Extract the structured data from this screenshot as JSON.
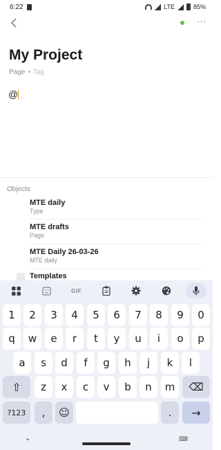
{
  "status": {
    "time": "6:22",
    "network": "LTE",
    "battery": "85%"
  },
  "page": {
    "title": "My Project",
    "type": "Page",
    "tag": "Tag",
    "editor_text": "@"
  },
  "objects": {
    "header": "Objects",
    "items": [
      {
        "name": "MTE daily",
        "sub": "Type"
      },
      {
        "name": "MTE drafts",
        "sub": "Page"
      },
      {
        "name": "MTE Daily 26-03-26",
        "sub": "MTE daily"
      },
      {
        "name": "Templates",
        "sub": ""
      }
    ]
  },
  "keyboard": {
    "toolbar": {
      "gif": "GIF"
    },
    "row_numbers": [
      "1",
      "2",
      "3",
      "4",
      "5",
      "6",
      "7",
      "8",
      "9",
      "0"
    ],
    "row_top": [
      "q",
      "w",
      "e",
      "r",
      "t",
      "y",
      "u",
      "i",
      "o",
      "p"
    ],
    "row_home": [
      "a",
      "s",
      "d",
      "f",
      "g",
      "h",
      "j",
      "k",
      "l"
    ],
    "row_bottom": [
      "z",
      "x",
      "c",
      "v",
      "b",
      "n",
      "m"
    ],
    "symbols_key": "?123",
    "comma_key": ",",
    "period_key": ".",
    "shift_icon": "⇧",
    "backspace_icon": "⌫",
    "enter_icon": "→",
    "emoji_icon": "☺"
  },
  "nav": {
    "back_chevron": "⌄",
    "kb_switch": "⌨"
  }
}
